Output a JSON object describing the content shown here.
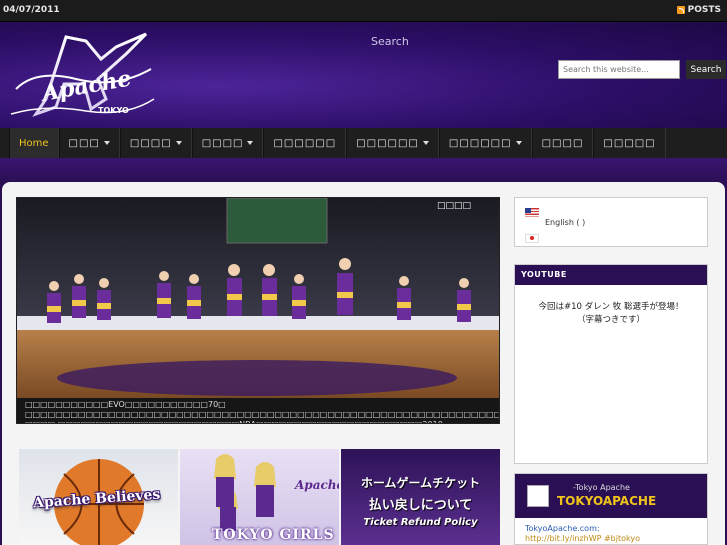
{
  "topbar": {
    "date": "04/07/2011",
    "posts_label": "POSTS"
  },
  "header": {
    "logo_alt": "Apache Tokyo",
    "search_label": "Search",
    "search_placeholder": "Search this website...",
    "search_button": "Search"
  },
  "nav": {
    "items": [
      {
        "label": "Home",
        "active": true,
        "dropdown": false
      },
      {
        "label": "□□□",
        "dropdown": true
      },
      {
        "label": "□□□□",
        "dropdown": true
      },
      {
        "label": "□□□□",
        "dropdown": true
      },
      {
        "label": "□□□□□□",
        "dropdown": false
      },
      {
        "label": "□□□□□□",
        "dropdown": true
      },
      {
        "label": "□□□□□□",
        "dropdown": true
      },
      {
        "label": "□□□□",
        "dropdown": false
      },
      {
        "label": "□□□□□",
        "dropdown": false
      }
    ]
  },
  "slider": {
    "tag": "□□□□",
    "caption": "□□□□□□□□□□□EVO□□□□□□□□□□□70□ □□□□□□□□□□□□□□□□□□□□□□□□□□□□□□□□□□□□□□□□□□□□□□□□□□□□□□□□□□□□□□□□□□□□□ □□□□ □□□□□□□□□□□□□□□□□□□□□□□□NBA□□□□□□□□□□□□□□□□□□□□□□2010-2011□□□□□□□□□□"
  },
  "banners": {
    "b1": "Apache Believes",
    "b2": "TOKYO GIRLS",
    "b3_l1": "ホームゲームチケット",
    "b3_l2": "払い戻しについて",
    "b3_l3": "Ticket Refund Policy"
  },
  "sidebar": {
    "lang_english": "English ( )",
    "youtube_title": "YOUTUBE",
    "youtube_line1": "今回は#10 ダレン 牧 聡選手が登場！",
    "youtube_line2": "（字幕つきです）",
    "twitter_sub": "-Tokyo Apache",
    "twitter_name": "TOKYOAPACHE",
    "tweet_user": "TokyoApache.com:",
    "tweet_link": "http://bit.ly/inzhWP #bjtokyo"
  },
  "colors": {
    "accent_purple": "#2a0f55",
    "gold": "#f0c419"
  }
}
